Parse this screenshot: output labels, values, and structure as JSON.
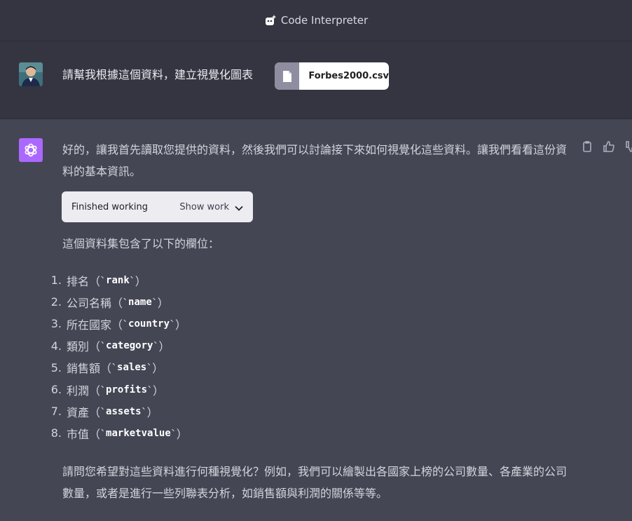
{
  "header": {
    "title": "Code Interpreter",
    "icon": "plugin-icon"
  },
  "user_message": {
    "text": "請幫我根據這個資料，建立視覺化圖表",
    "attachment": {
      "filename": "Forbes2000.csv",
      "icon": "file-icon"
    }
  },
  "assistant_message": {
    "intro": "好的，讓我首先讀取您提供的資料，然後我們可以討論接下來如何視覺化這些資料。讓我們看看這份資料的基本資訊。",
    "work_box": {
      "status": "Finished working",
      "toggle_label": "Show work"
    },
    "columns_intro": "這個資料集包含了以下的欄位：",
    "fields": [
      {
        "num": "1.",
        "label": "排名",
        "code": "rank"
      },
      {
        "num": "2.",
        "label": "公司名稱",
        "code": "name"
      },
      {
        "num": "3.",
        "label": "所在國家",
        "code": "country"
      },
      {
        "num": "4.",
        "label": "類別",
        "code": "category"
      },
      {
        "num": "5.",
        "label": "銷售額",
        "code": "sales"
      },
      {
        "num": "6.",
        "label": "利潤",
        "code": "profits"
      },
      {
        "num": "7.",
        "label": "資產",
        "code": "assets"
      },
      {
        "num": "8.",
        "label": "市值",
        "code": "marketvalue"
      }
    ],
    "closing": "請問您希望對這些資料進行何種視覺化？例如，我們可以繪製出各國家上榜的公司數量、各產業的公司數量，或者是進行一些列聯表分析，如銷售額與利潤的關係等等。"
  },
  "colors": {
    "background": "#444654",
    "header": "#343541",
    "gpt_avatar": "#ab68ff"
  }
}
